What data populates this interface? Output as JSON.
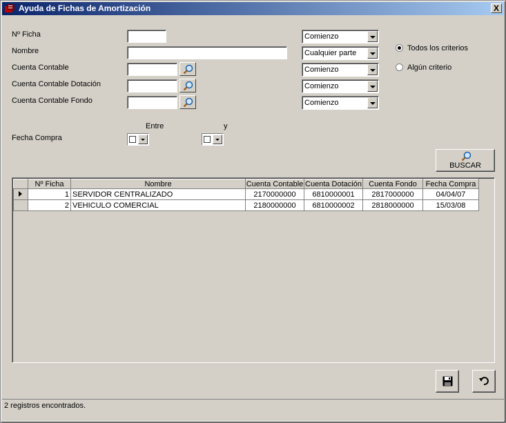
{
  "window": {
    "title": "Ayuda de Fichas de Amortización",
    "close_label": "X"
  },
  "filters": {
    "ficha": {
      "label": "Nº Ficha",
      "value": "",
      "mode": "Comienzo"
    },
    "nombre": {
      "label": "Nombre",
      "value": "",
      "mode": "Cualquier parte"
    },
    "cuenta_contable": {
      "label": "Cuenta Contable",
      "value": "",
      "mode": "Comienzo"
    },
    "cuenta_dotacion": {
      "label": "Cuenta Contable Dotación",
      "value": "",
      "mode": "Comienzo"
    },
    "cuenta_fondo": {
      "label": "Cuenta Contable Fondo",
      "value": "",
      "mode": "Comienzo"
    },
    "fecha_compra": {
      "label": "Fecha Compra",
      "between_label": "Entre",
      "and_label": "y"
    }
  },
  "criteria": {
    "all_label": "Todos los criterios",
    "any_label": "Algún criterio",
    "selected": "all"
  },
  "search_button": {
    "label": "BUSCAR",
    "icon": "magnifier-icon"
  },
  "grid": {
    "columns": [
      "Nº Ficha",
      "Nombre",
      "Cuenta Contable",
      "Cuenta Dotación",
      "Cuenta Fondo",
      "Fecha Compra"
    ],
    "rows": [
      {
        "ficha": "1",
        "nombre": "SERVIDOR CENTRALIZADO",
        "cuenta_contable": "2170000000",
        "cuenta_dotacion": "6810000001",
        "cuenta_fondo": "2817000000",
        "fecha_compra": "04/04/07",
        "current": true
      },
      {
        "ficha": "2",
        "nombre": "VEHICULO COMERCIAL",
        "cuenta_contable": "2180000000",
        "cuenta_dotacion": "6810000002",
        "cuenta_fondo": "2818000000",
        "fecha_compra": "15/03/08",
        "current": false
      }
    ]
  },
  "actions": {
    "save_icon": "floppy-disk-icon",
    "undo_icon": "undo-arrow-icon"
  },
  "status": {
    "text": "2 registros encontrados."
  },
  "colors": {
    "titlebar_start": "#0a246a",
    "titlebar_end": "#a6caf0",
    "face": "#d4d0c8"
  }
}
